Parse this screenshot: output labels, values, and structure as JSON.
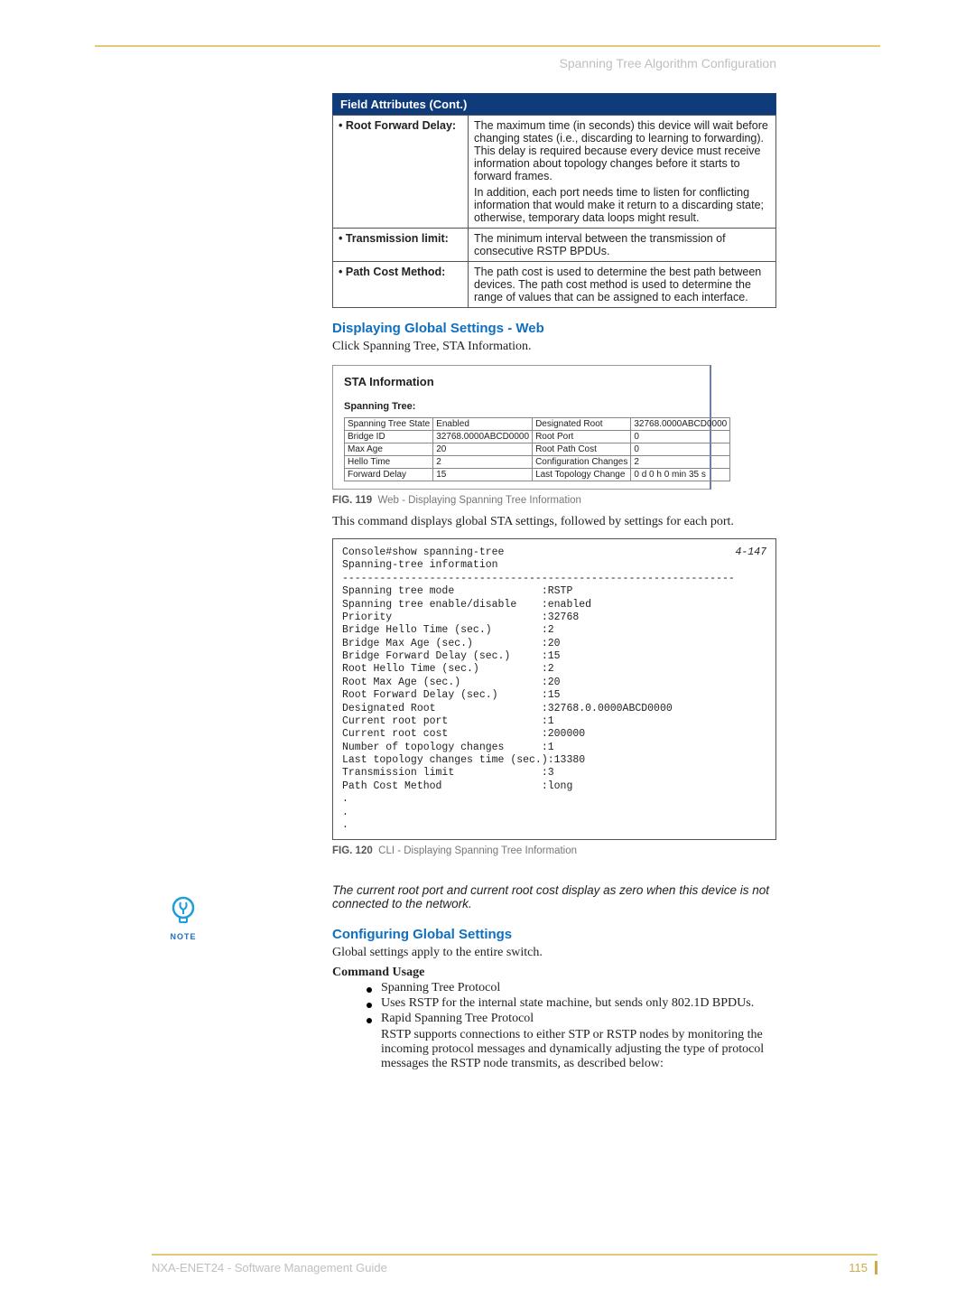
{
  "header": {
    "title": "Spanning Tree Algorithm Configuration"
  },
  "attr_table": {
    "heading": "Field Attributes (Cont.)",
    "rows": [
      {
        "label": "Root Forward Delay:",
        "desc": "The maximum time (in seconds) this device will wait before changing states (i.e., discarding to learning to forwarding). This delay is required because every device must receive information about topology changes before it starts to forward frames.",
        "desc2": "In addition, each port needs time to listen for conflicting information that would make it return to a discarding state; otherwise, temporary data loops might result."
      },
      {
        "label": "Transmission limit:",
        "desc": "The minimum interval between the transmission of consecutive RSTP BPDUs."
      },
      {
        "label": "Path Cost Method:",
        "desc": "The path cost is used to determine the best path between devices. The path cost method is used to determine the range of values that can be assigned to each interface."
      }
    ]
  },
  "section1": {
    "title": "Displaying Global Settings - Web",
    "intro": "Click Spanning Tree, STA Information."
  },
  "sta_panel": {
    "title": "STA Information",
    "subhead": "Spanning Tree:",
    "grid": [
      [
        "Spanning Tree State",
        "Enabled",
        "Designated Root",
        "32768.0000ABCD0000"
      ],
      [
        "Bridge ID",
        "32768.0000ABCD0000",
        "Root Port",
        "0"
      ],
      [
        "Max Age",
        "20",
        "Root Path Cost",
        "0"
      ],
      [
        "Hello Time",
        "2",
        "Configuration Changes",
        "2"
      ],
      [
        "Forward Delay",
        "15",
        "Last Topology Change",
        "0 d 0 h 0 min 35 s"
      ]
    ]
  },
  "fig119": {
    "num": "FIG. 119",
    "text": "Web - Displaying Spanning Tree Information"
  },
  "para_after_fig119": "This command displays global STA settings, followed by settings for each port.",
  "cli": {
    "prompt": "Console#show spanning-tree",
    "ref": "4-147",
    "lines": [
      "Spanning-tree information",
      "---------------------------------------------------------------",
      "Spanning tree mode              :RSTP",
      "Spanning tree enable/disable    :enabled",
      "Priority                        :32768",
      "Bridge Hello Time (sec.)        :2",
      "Bridge Max Age (sec.)           :20",
      "Bridge Forward Delay (sec.)     :15",
      "Root Hello Time (sec.)          :2",
      "Root Max Age (sec.)             :20",
      "Root Forward Delay (sec.)       :15",
      "Designated Root                 :32768.0.0000ABCD0000",
      "Current root port               :1",
      "Current root cost               :200000",
      "Number of topology changes      :1",
      "Last topology changes time (sec.):13380",
      "Transmission limit              :3",
      "Path Cost Method                :long"
    ]
  },
  "fig120": {
    "num": "FIG. 120",
    "text": "CLI - Displaying Spanning Tree Information"
  },
  "note": {
    "label": "NOTE",
    "text": "The current root port and current root cost display as zero when this device is not connected to the network."
  },
  "section2": {
    "title": "Configuring Global Settings",
    "intro": "Global settings apply to the entire switch.",
    "cmd_usage": "Command Usage",
    "items": [
      "Spanning Tree Protocol",
      "Uses RSTP for the internal state machine, but sends only 802.1D BPDUs.",
      "Rapid Spanning Tree Protocol"
    ],
    "rstp_para": "RSTP supports connections to either STP or RSTP nodes by monitoring the incoming protocol messages and dynamically adjusting the type of protocol messages the RSTP node transmits, as described below:"
  },
  "footer": {
    "left": "NXA-ENET24 - Software Management Guide",
    "page": "115"
  }
}
